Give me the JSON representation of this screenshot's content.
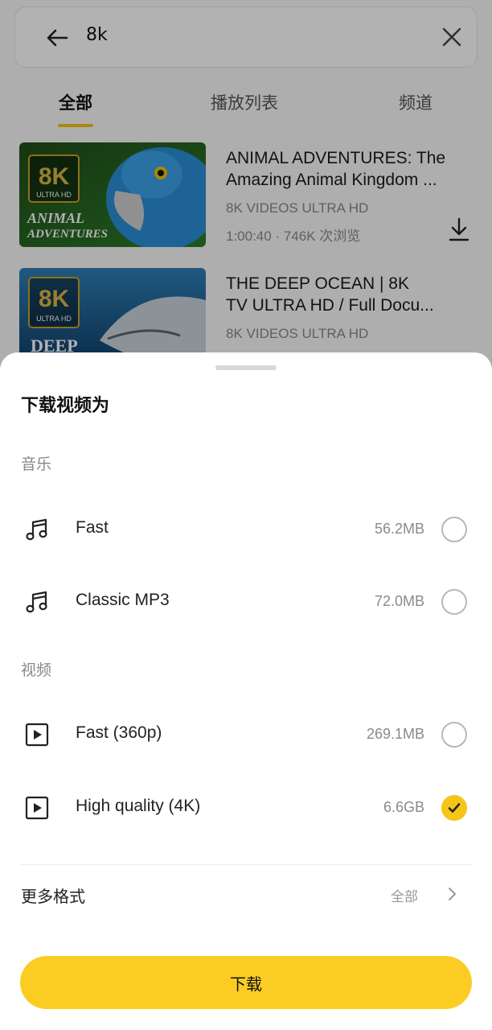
{
  "search": {
    "query": "8k"
  },
  "tabs": [
    {
      "label": "全部",
      "active": true
    },
    {
      "label": "播放列表",
      "active": false
    },
    {
      "label": "频道",
      "active": false
    }
  ],
  "results": [
    {
      "title_line1": "ANIMAL ADVENTURES: The",
      "title_line2": "Amazing Animal Kingdom ...",
      "channel": "8K VIDEOS ULTRA HD",
      "meta": "1:00:40 · 746K 次浏览",
      "thumb_badge": "8K",
      "thumb_badge_sub": "ULTRA HD",
      "thumb_caption_1": "ANIMAL",
      "thumb_caption_2": "ADVENTURES"
    },
    {
      "title_line1": "THE DEEP OCEAN | 8K",
      "title_line2": "TV ULTRA HD / Full Docu...",
      "channel": "8K VIDEOS ULTRA HD",
      "thumb_badge": "8K",
      "thumb_badge_sub": "ULTRA HD",
      "thumb_caption_1": "DEEP"
    }
  ],
  "sheet": {
    "title": "下载视频为",
    "music_section": "音乐",
    "video_section": "视频",
    "music_options": [
      {
        "label": "Fast",
        "size": "56.2MB",
        "selected": false,
        "icon": "music-note-icon"
      },
      {
        "label": "Classic MP3",
        "size": "72.0MB",
        "selected": false,
        "icon": "music-note-icon"
      }
    ],
    "video_options": [
      {
        "label": "Fast (360p)",
        "size": "269.1MB",
        "selected": false,
        "icon": "video-play-icon"
      },
      {
        "label": "High quality (4K)",
        "size": "6.6GB",
        "selected": true,
        "icon": "video-play-icon"
      }
    ],
    "more_formats": {
      "label": "更多格式",
      "value": "全部"
    },
    "download_button": "下载"
  },
  "colors": {
    "accent": "#fbcd24",
    "checked": "#f5c518"
  }
}
